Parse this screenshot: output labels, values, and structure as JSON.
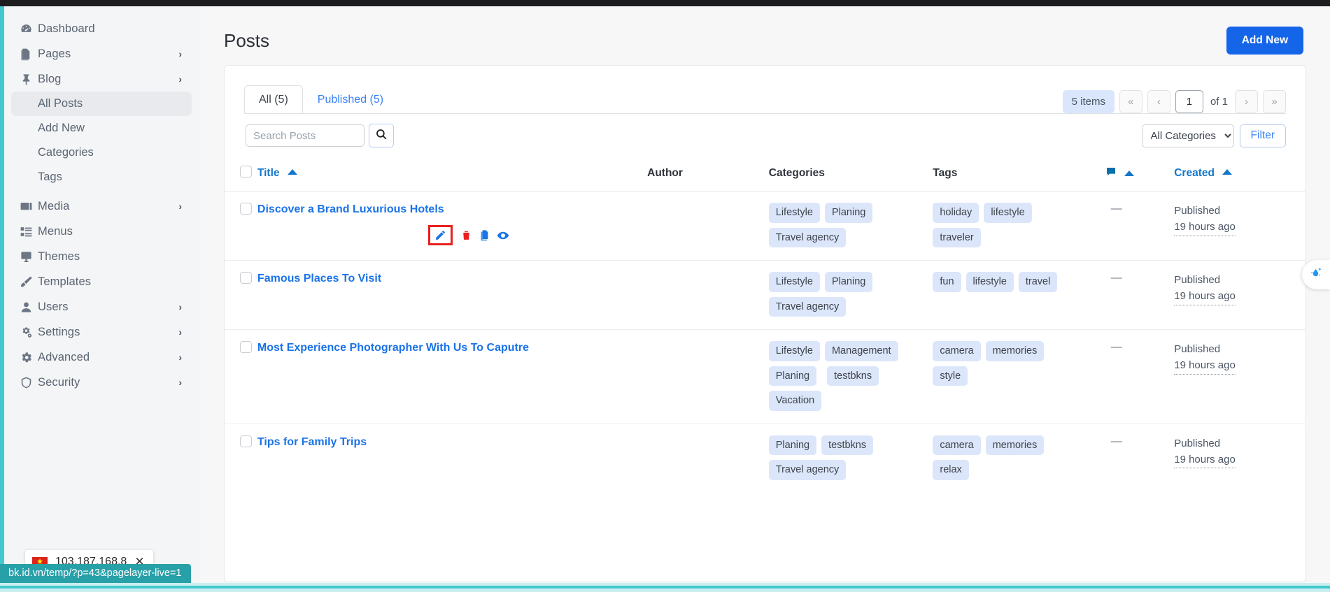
{
  "sidebar": {
    "items": [
      {
        "label": "Dashboard",
        "icon": "dashboard-icon",
        "expandable": false
      },
      {
        "label": "Pages",
        "icon": "pages-icon",
        "expandable": true
      },
      {
        "label": "Blog",
        "icon": "pin-icon",
        "expandable": true
      }
    ],
    "blog_children": [
      {
        "label": "All Posts",
        "active": true
      },
      {
        "label": "Add New",
        "active": false
      },
      {
        "label": "Categories",
        "active": false
      },
      {
        "label": "Tags",
        "active": false
      }
    ],
    "items_after": [
      {
        "label": "Media",
        "icon": "media-icon",
        "expandable": true
      },
      {
        "label": "Menus",
        "icon": "menus-icon",
        "expandable": false
      },
      {
        "label": "Themes",
        "icon": "themes-icon",
        "expandable": false
      },
      {
        "label": "Templates",
        "icon": "brush-icon",
        "expandable": false
      },
      {
        "label": "Users",
        "icon": "user-icon",
        "expandable": true
      },
      {
        "label": "Settings",
        "icon": "gears-icon",
        "expandable": true
      },
      {
        "label": "Advanced",
        "icon": "gear-icon",
        "expandable": true
      },
      {
        "label": "Security",
        "icon": "shield-icon",
        "expandable": true
      }
    ]
  },
  "header": {
    "title": "Posts",
    "add_new_label": "Add New"
  },
  "tabs": [
    {
      "label": "All (5)",
      "active": true
    },
    {
      "label": "Published (5)",
      "active": false
    }
  ],
  "pager": {
    "items_label": "5 items",
    "first": "«",
    "prev": "‹",
    "page_value": "1",
    "of_label": "of 1",
    "next": "›",
    "last": "»"
  },
  "search": {
    "placeholder": "Search Posts",
    "value": "",
    "button_icon": "search-icon"
  },
  "filters": {
    "category_selected": "All Categories",
    "filter_label": "Filter"
  },
  "table": {
    "columns": {
      "title": "Title",
      "author": "Author",
      "categories": "Categories",
      "tags": "Tags",
      "comments_icon": "comment-icon",
      "created": "Created"
    },
    "rows": [
      {
        "title": "Discover a Brand Luxurious Hotels",
        "author": "",
        "categories": [
          "Lifestyle",
          "Planing",
          "Travel agency"
        ],
        "tags": [
          "holiday",
          "lifestyle",
          "traveler"
        ],
        "comments": "—",
        "status": "Published",
        "created": "19 hours ago",
        "actions": [
          "edit-icon",
          "delete-icon",
          "duplicate-icon",
          "preview-icon"
        ],
        "actions_visible": true
      },
      {
        "title": "Famous Places To Visit",
        "author": "",
        "categories": [
          "Lifestyle",
          "Planing",
          "Travel agency"
        ],
        "tags": [
          "fun",
          "lifestyle",
          "travel"
        ],
        "comments": "—",
        "status": "Published",
        "created": "19 hours ago",
        "actions_visible": false
      },
      {
        "title": "Most Experience Photographer With Us To Caputre",
        "author": "",
        "categories": [
          "Lifestyle",
          "Management",
          "Planing",
          "testbkns",
          "Vacation"
        ],
        "tags": [
          "camera",
          "memories",
          "style"
        ],
        "comments": "—",
        "status": "Published",
        "created": "19 hours ago",
        "actions_visible": false
      },
      {
        "title": "Tips for Family Trips",
        "author": "",
        "categories": [
          "Planing",
          "testbkns",
          "Travel agency"
        ],
        "tags": [
          "camera",
          "memories",
          "relax"
        ],
        "comments": "—",
        "status": "Published",
        "created": "19 hours ago",
        "actions_visible": false
      }
    ]
  },
  "float_widget": {
    "icon": "water-drop-sparkle-icon"
  },
  "statusbar": {
    "flag": "vietnam-flag-icon",
    "ip": "103.187.168.8",
    "close_icon": "close-icon",
    "url": "bk.id.vn/temp/?p=43&pagelayer-live=1"
  },
  "colors": {
    "accent_blue": "#1565e8",
    "link_blue": "#1a73e8",
    "pill_bg": "#dce6fa",
    "teal": "#45c8cd",
    "highlight_red": "#e8201f"
  }
}
